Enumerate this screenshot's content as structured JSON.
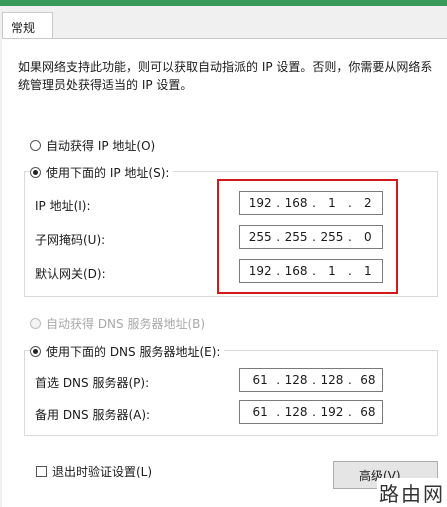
{
  "tab": {
    "label": "常规"
  },
  "description": "如果网络支持此功能，则可以获取自动指派的 IP 设置。否则，你需要从网络系统管理员处获得适当的 IP 设置。",
  "ip_section": {
    "auto_label": "自动获得 IP 地址(O)",
    "manual_label": "使用下面的 IP 地址(S):",
    "fields": [
      {
        "label": "IP 地址(I):",
        "octets": [
          "192",
          "168",
          "1",
          "2"
        ]
      },
      {
        "label": "子网掩码(U):",
        "octets": [
          "255",
          "255",
          "255",
          "0"
        ]
      },
      {
        "label": "默认网关(D):",
        "octets": [
          "192",
          "168",
          "1",
          "1"
        ]
      }
    ]
  },
  "dns_section": {
    "auto_label": "自动获得 DNS 服务器地址(B)",
    "manual_label": "使用下面的 DNS 服务器地址(E):",
    "fields": [
      {
        "label": "首选 DNS 服务器(P):",
        "octets": [
          "61",
          "128",
          "128",
          "68"
        ]
      },
      {
        "label": "备用 DNS 服务器(A):",
        "octets": [
          "61",
          "128",
          "192",
          "68"
        ]
      }
    ]
  },
  "validate_label": "退出时验证设置(L)",
  "advanced_button": "高级(V)...",
  "watermark": "路由网",
  "colors": {
    "highlight": "#d4191b",
    "titlebar": "#3a9a5c"
  }
}
